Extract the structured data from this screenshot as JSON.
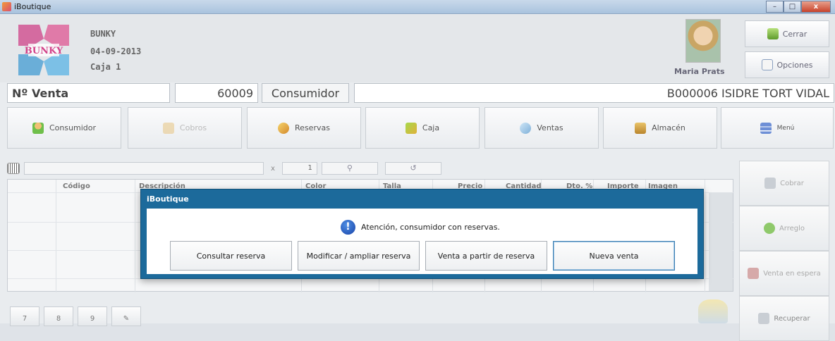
{
  "window": {
    "title": "iBoutique",
    "min": "–",
    "max": "□",
    "close": "x"
  },
  "store": {
    "name": "BUNKY",
    "date": "04-09-2013",
    "register": "Caja 1",
    "logo_text": "BUNKY"
  },
  "user": {
    "name": "Maria Prats"
  },
  "top_buttons": {
    "close": "Cerrar",
    "options": "Opciones"
  },
  "sale": {
    "label": "Nº Venta",
    "number": "60009",
    "consumer_label": "Consumidor",
    "consumer_value": "B000006 ISIDRE TORT VIDAL"
  },
  "nav": [
    {
      "label": "Consumidor"
    },
    {
      "label": "Cobros"
    },
    {
      "label": "Reservas"
    },
    {
      "label": "Caja"
    },
    {
      "label": "Ventas"
    },
    {
      "label": "Almacén"
    },
    {
      "label": "Menú"
    }
  ],
  "toolbar": {
    "times": "x",
    "qty": "1"
  },
  "table": {
    "headers": [
      "Código",
      "Descripción",
      "Color",
      "Talla",
      "Precio",
      "Cantidad",
      "Dto. %",
      "Importe",
      "Imagen"
    ]
  },
  "side": [
    {
      "label": "Cobrar"
    },
    {
      "label": "Arreglo"
    },
    {
      "label": "Venta en espera"
    },
    {
      "label": "Recuperar"
    }
  ],
  "numpad": [
    "7",
    "8",
    "9"
  ],
  "dialog": {
    "title": "iBoutique",
    "message": "Atención, consumidor con reservas.",
    "buttons": {
      "consult": "Consultar reserva",
      "modify": "Modificar / ampliar reserva",
      "from_reserve": "Venta a partir de reserva",
      "new_sale": "Nueva venta"
    }
  },
  "colors": {
    "dialog_frame": "#1c6a9b",
    "info_icon": "#1742a8"
  }
}
